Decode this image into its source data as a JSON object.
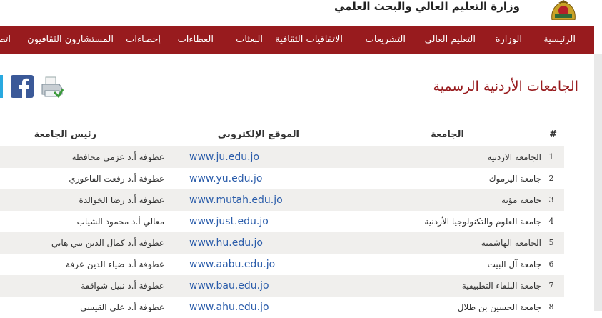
{
  "header": {
    "ministry_name": "وزارة التعليم العالي والبحث العلمي",
    "logo_icon": "coat-of-arms-icon"
  },
  "nav": {
    "items": [
      {
        "label": "الرئيسية"
      },
      {
        "label": "الوزارة"
      },
      {
        "label": "التعليم العالي"
      },
      {
        "label": "التشريعات"
      },
      {
        "label": "الاتفاقيات الثقافية"
      },
      {
        "label": "البعثات"
      },
      {
        "label": "العطاءات"
      },
      {
        "label": "إحصاءات"
      },
      {
        "label": "المستشارون الثقافيون"
      },
      {
        "label": "اتصل"
      }
    ]
  },
  "page": {
    "title": "الجامعات الأردنية الرسمية"
  },
  "social": {
    "print_icon": "printer-icon",
    "facebook_icon": "facebook-icon",
    "twitter_icon": "twitter-icon"
  },
  "table": {
    "headers": {
      "num": "#",
      "university": "الجامعة",
      "website": "الموقع الإلكتروني",
      "president": "رئيس الجامعة"
    },
    "rows": [
      {
        "num": "1",
        "university": "الجامعة الاردنية",
        "website": "www.ju.edu.jo",
        "president": "عطوفة أ.د عزمي محافظة"
      },
      {
        "num": "2",
        "university": "جامعة اليرموك",
        "website": "www.yu.edu.jo",
        "president": "عطوفة أ.د رفعت الفاعوري"
      },
      {
        "num": "3",
        "university": "جامعة مؤتة",
        "website": "www.mutah.edu.jo",
        "president": "عطوفة أ.د رضا الخوالدة"
      },
      {
        "num": "4",
        "university": "جامعة العلوم والتكنولوجيا الأردنية",
        "website": "www.just.edu.jo",
        "president": "معالي أ.د محمود الشياب"
      },
      {
        "num": "5",
        "university": "الجامعة الهاشمية",
        "website": "www.hu.edu.jo",
        "president": "عطوفة أ.د كمال الدين بني هاني"
      },
      {
        "num": "6",
        "university": "جامعة آل البيت",
        "website": "www.aabu.edu.jo",
        "president": "عطوفة أ.د ضياء الدين عرفة"
      },
      {
        "num": "7",
        "university": "جامعة البلقاء التطبيقية",
        "website": "www.bau.edu.jo",
        "president": "عطوفة أ.د نبيل شواقفة"
      },
      {
        "num": "8",
        "university": "جامعة الحسين بن طلال",
        "website": "www.ahu.edu.jo",
        "president": "عطوفة أ.د علي القيسي"
      }
    ]
  },
  "colors": {
    "brand": "#981b1e",
    "link": "#2a5caa",
    "stripe": "#f0efed"
  }
}
